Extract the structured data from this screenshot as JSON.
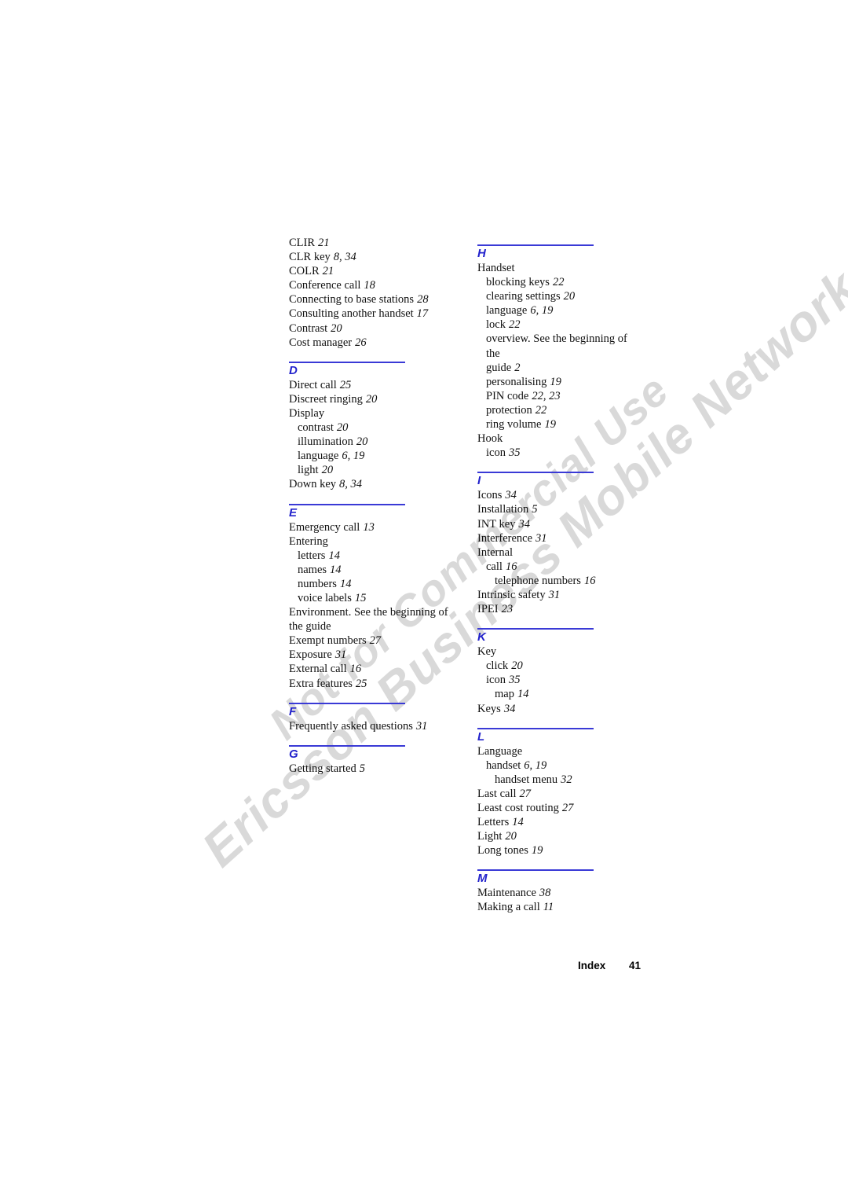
{
  "document": {
    "kind": "manual-index-page",
    "accent_color": "#3a3ad6",
    "heading_color": "#2222cc",
    "watermark_color": "#d9d9d9"
  },
  "watermark": {
    "line1": "Ericsson Business Mobile Networks BV",
    "line2": "Not for Commercial Use"
  },
  "footer": {
    "label": "Index",
    "page": "41"
  },
  "columns": [
    {
      "name": "left-column",
      "sections": [
        {
          "letter": "",
          "has_rule": false,
          "entries": [
            {
              "text": "CLIR",
              "pages": "21",
              "level": 0
            },
            {
              "text": "CLR key",
              "pages": "8, 34",
              "level": 0
            },
            {
              "text": "COLR",
              "pages": "21",
              "level": 0
            },
            {
              "text": "Conference call",
              "pages": "18",
              "level": 0
            },
            {
              "text": "Connecting to base stations",
              "pages": "28",
              "level": 0
            },
            {
              "text": "Consulting another handset",
              "pages": "17",
              "level": 0
            },
            {
              "text": "Contrast",
              "pages": "20",
              "level": 0
            },
            {
              "text": "Cost manager",
              "pages": "26",
              "level": 0
            }
          ]
        },
        {
          "letter": "D",
          "has_rule": true,
          "entries": [
            {
              "text": "Direct call",
              "pages": "25",
              "level": 0
            },
            {
              "text": "Discreet ringing",
              "pages": "20",
              "level": 0
            },
            {
              "text": "Display",
              "pages": "",
              "level": 0
            },
            {
              "text": "contrast",
              "pages": "20",
              "level": 1
            },
            {
              "text": "illumination",
              "pages": "20",
              "level": 1
            },
            {
              "text": "language",
              "pages": "6, 19",
              "level": 1
            },
            {
              "text": "light",
              "pages": "20",
              "level": 1
            },
            {
              "text": "Down key",
              "pages": "8, 34",
              "level": 0
            }
          ]
        },
        {
          "letter": "E",
          "has_rule": true,
          "entries": [
            {
              "text": "Emergency call",
              "pages": "13",
              "level": 0
            },
            {
              "text": "Entering",
              "pages": "",
              "level": 0
            },
            {
              "text": "letters",
              "pages": "14",
              "level": 1
            },
            {
              "text": "names",
              "pages": "14",
              "level": 1
            },
            {
              "text": "numbers",
              "pages": "14",
              "level": 1
            },
            {
              "text": "voice labels",
              "pages": "15",
              "level": 1
            },
            {
              "text": "Environment. See the beginning of",
              "pages": "",
              "level": 0
            },
            {
              "text": "the guide",
              "pages": "",
              "level": 0
            },
            {
              "text": "Exempt numbers",
              "pages": "27",
              "level": 0
            },
            {
              "text": "Exposure",
              "pages": "31",
              "level": 0
            },
            {
              "text": "External call",
              "pages": "16",
              "level": 0
            },
            {
              "text": "Extra features",
              "pages": "25",
              "level": 0
            }
          ]
        },
        {
          "letter": "F",
          "has_rule": true,
          "entries": [
            {
              "text": "Frequently asked questions",
              "pages": "31",
              "level": 0
            }
          ]
        },
        {
          "letter": "G",
          "has_rule": true,
          "entries": [
            {
              "text": "Getting started",
              "pages": "5",
              "level": 0
            }
          ]
        }
      ]
    },
    {
      "name": "right-column",
      "sections": [
        {
          "letter": "H",
          "has_rule": true,
          "entries": [
            {
              "text": "Handset",
              "pages": "",
              "level": 0
            },
            {
              "text": "blocking keys",
              "pages": "22",
              "level": 1
            },
            {
              "text": "clearing settings",
              "pages": "20",
              "level": 1
            },
            {
              "text": "language",
              "pages": "6, 19",
              "level": 1
            },
            {
              "text": "lock",
              "pages": "22",
              "level": 1
            },
            {
              "text": "overview. See the beginning of the",
              "pages": "",
              "level": 1
            },
            {
              "text": "guide",
              "pages": "2",
              "level": 1
            },
            {
              "text": "personalising",
              "pages": "19",
              "level": 1
            },
            {
              "text": "PIN code",
              "pages": "22, 23",
              "level": 1
            },
            {
              "text": "protection",
              "pages": "22",
              "level": 1
            },
            {
              "text": "ring volume",
              "pages": "19",
              "level": 1
            },
            {
              "text": "Hook",
              "pages": "",
              "level": 0
            },
            {
              "text": "icon",
              "pages": "35",
              "level": 1
            }
          ]
        },
        {
          "letter": "I",
          "has_rule": true,
          "entries": [
            {
              "text": "Icons",
              "pages": "34",
              "level": 0
            },
            {
              "text": "Installation",
              "pages": "5",
              "level": 0
            },
            {
              "text": "INT key",
              "pages": "34",
              "level": 0
            },
            {
              "text": "Interference",
              "pages": "31",
              "level": 0
            },
            {
              "text": "Internal",
              "pages": "",
              "level": 0
            },
            {
              "text": "call",
              "pages": "16",
              "level": 1
            },
            {
              "text": "telephone numbers",
              "pages": "16",
              "level": 2
            },
            {
              "text": "Intrinsic safety",
              "pages": "31",
              "level": 0
            },
            {
              "text": "IPEI",
              "pages": "23",
              "level": 0
            }
          ]
        },
        {
          "letter": "K",
          "has_rule": true,
          "entries": [
            {
              "text": "Key",
              "pages": "",
              "level": 0
            },
            {
              "text": "click",
              "pages": "20",
              "level": 1
            },
            {
              "text": "icon",
              "pages": "35",
              "level": 1
            },
            {
              "text": "map",
              "pages": "14",
              "level": 2
            },
            {
              "text": "Keys",
              "pages": "34",
              "level": 0
            }
          ]
        },
        {
          "letter": "L",
          "has_rule": true,
          "entries": [
            {
              "text": "Language",
              "pages": "",
              "level": 0
            },
            {
              "text": "handset",
              "pages": "6, 19",
              "level": 1
            },
            {
              "text": "handset menu",
              "pages": "32",
              "level": 2
            },
            {
              "text": "Last call",
              "pages": "27",
              "level": 0
            },
            {
              "text": "Least cost routing",
              "pages": "27",
              "level": 0
            },
            {
              "text": "Letters",
              "pages": "14",
              "level": 0
            },
            {
              "text": "Light",
              "pages": "20",
              "level": 0
            },
            {
              "text": "Long tones",
              "pages": "19",
              "level": 0
            }
          ]
        },
        {
          "letter": "M",
          "has_rule": true,
          "entries": [
            {
              "text": "Maintenance",
              "pages": "38",
              "level": 0
            },
            {
              "text": "Making a call",
              "pages": "11",
              "level": 0
            }
          ]
        }
      ]
    }
  ]
}
